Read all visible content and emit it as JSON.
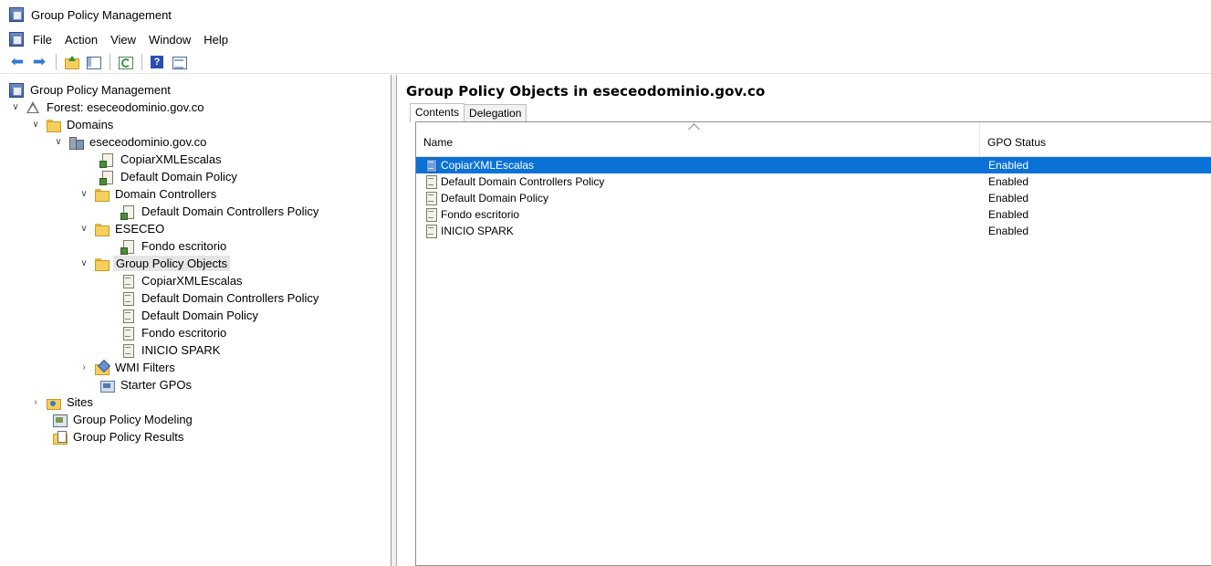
{
  "window": {
    "title": "Group Policy Management"
  },
  "menu": {
    "items": [
      "File",
      "Action",
      "View",
      "Window",
      "Help"
    ]
  },
  "toolbar": {
    "buttons": [
      "back-arrow-icon",
      "forward-arrow-icon",
      "up-folder-icon",
      "show-hide-pane-icon",
      "refresh-icon",
      "help-icon",
      "view-icon"
    ]
  },
  "tree": {
    "root": "Group Policy Management",
    "forest": "Forest: eseceodominio.gov.co",
    "domains": "Domains",
    "domain": "eseceodominio.gov.co",
    "link_copiar": "CopiarXMLEscalas",
    "link_default_domain": "Default Domain Policy",
    "ou_domain_controllers": "Domain Controllers",
    "link_ddc_policy": "Default Domain Controllers Policy",
    "ou_eseceo": "ESECEO",
    "link_fondo": "Fondo escritorio",
    "gpo_container": "Group Policy Objects",
    "gpo_copiar": "CopiarXMLEscalas",
    "gpo_ddc": "Default Domain Controllers Policy",
    "gpo_ddp": "Default Domain Policy",
    "gpo_fondo": "Fondo escritorio",
    "gpo_inicio": "INICIO SPARK",
    "wmi": "WMI Filters",
    "starter": "Starter GPOs",
    "sites": "Sites",
    "modeling": "Group Policy Modeling",
    "results": "Group Policy Results"
  },
  "content": {
    "title": "Group Policy Objects in eseceodominio.gov.co",
    "tabs": [
      "Contents",
      "Delegation"
    ],
    "columns": {
      "name": "Name",
      "status": "GPO Status"
    },
    "rows": [
      {
        "name": "CopiarXMLEscalas",
        "status": "Enabled"
      },
      {
        "name": "Default Domain Controllers Policy",
        "status": "Enabled"
      },
      {
        "name": "Default Domain Policy",
        "status": "Enabled"
      },
      {
        "name": "Fondo escritorio",
        "status": "Enabled"
      },
      {
        "name": "INICIO SPARK",
        "status": "Enabled"
      }
    ]
  },
  "colors": {
    "selection": "#0a72d7",
    "tree_selection": "#e5e5e5"
  }
}
